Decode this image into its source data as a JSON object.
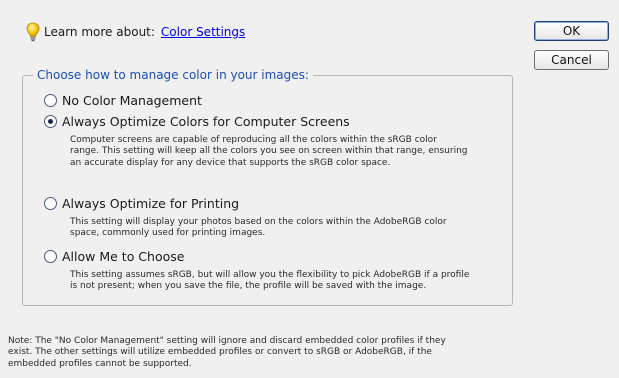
{
  "learn": {
    "label": "Learn more about:",
    "link": "Color Settings"
  },
  "buttons": {
    "ok": "OK",
    "cancel": "Cancel"
  },
  "group": {
    "legend": "Choose how to manage color in your images:",
    "selected": "optimize_screens",
    "options": [
      {
        "id": "no_management",
        "label": "No Color Management",
        "description": ""
      },
      {
        "id": "optimize_screens",
        "label": "Always Optimize Colors for Computer Screens",
        "description_lines": [
          "Computer screens are capable of reproducing all the colors within the sRGB color",
          "range. This setting will keep all the colors you see on screen within that range, ensuring",
          "an accurate display for any device that supports the sRGB color space."
        ]
      },
      {
        "id": "optimize_printing",
        "label": "Always Optimize for Printing",
        "description_lines": [
          "This setting will display your photos based on the colors within the AdobeRGB color",
          "space, commonly used for printing images."
        ]
      },
      {
        "id": "allow_choose",
        "label": "Allow Me to Choose",
        "description_lines": [
          "This setting assumes sRGB, but will allow you the flexibility to pick AdobeRGB if a profile",
          "is not present; when you save the file, the profile will be saved with the image."
        ]
      }
    ]
  },
  "note_lines": [
    "Note: The \"No Color Management\" setting will ignore and discard embedded color profiles if they",
    "exist. The other settings will utilize embedded profiles or convert to sRGB or AdobeRGB, if the",
    "embedded profiles cannot be supported."
  ],
  "colors": {
    "link": "#0000ee",
    "legend": "#1a4fb5",
    "background": "#f0f0f0"
  },
  "icons": {
    "help": "lightbulb-icon"
  }
}
